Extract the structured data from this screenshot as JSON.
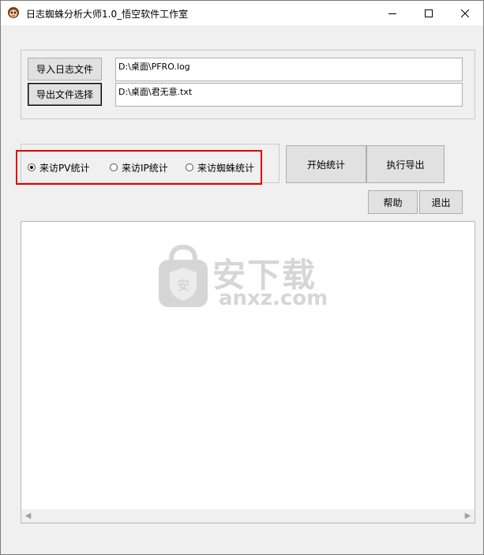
{
  "window": {
    "title": "日志蜘蛛分析大师1.0_悟空软件工作室"
  },
  "files": {
    "import_button": "导入日志文件",
    "export_button": "导出文件选择",
    "import_path": "D:\\桌面\\PFRO.log",
    "export_path": "D:\\桌面\\君无意.txt"
  },
  "stats": {
    "options": [
      "来访PV统计",
      "来访IP统计",
      "来访蜘蛛统计"
    ],
    "selected": "来访PV统计"
  },
  "actions": {
    "start": "开始统计",
    "export": "执行导出",
    "help": "帮助",
    "exit": "退出"
  },
  "watermark": {
    "cn": "安下载",
    "en": "anxz.com"
  },
  "icons": {
    "app": "spider-face-icon",
    "minimize": "minimize-icon",
    "maximize": "maximize-icon",
    "close": "close-icon"
  }
}
